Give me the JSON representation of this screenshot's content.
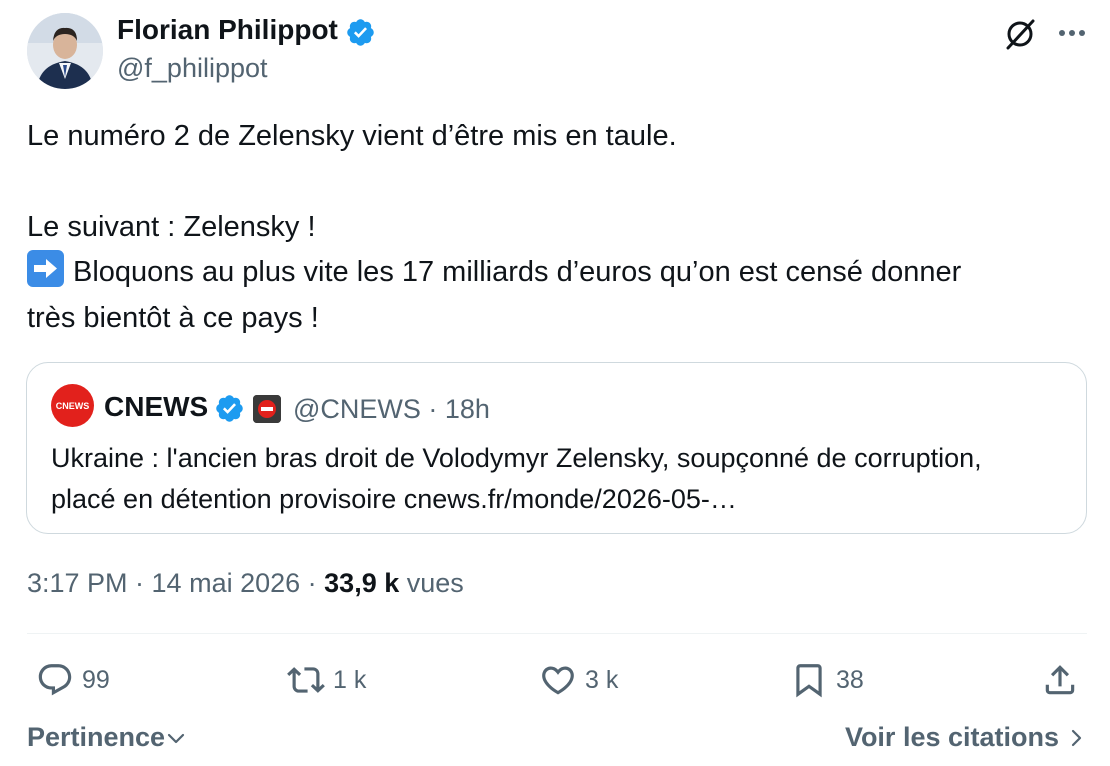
{
  "author": {
    "display_name": "Florian Philippot",
    "handle": "@f_philippot"
  },
  "tweet": {
    "line1": "Le numéro 2 de Zelensky vient d’être mis en taule.",
    "line2": "Le suivant : Zelensky !",
    "line3": "Bloquons au plus vite les 17 milliards d’euros qu’on est censé donner",
    "line4": "très bientôt à ce pays !"
  },
  "quoted": {
    "display_name": "CNEWS",
    "avatar_text": "CNEWS",
    "meta": "@CNEWS · 18h",
    "text_line1": "Ukraine : l'ancien bras droit de Volodymyr Zelensky, soupçonné de corruption,",
    "text_line2": "placé en détention provisoire cnews.fr/monde/2026-05-…"
  },
  "timestamp": {
    "time_date": "3:17 PM · 14 mai 2026 · ",
    "views_count": "33,9 k",
    "views_label": "vues"
  },
  "actions": {
    "replies": "99",
    "reposts": "1 k",
    "likes": "3 k",
    "bookmarks": "38"
  },
  "footer": {
    "sort_label": "Pertinence",
    "quotes_link": "Voir les citations"
  },
  "colors": {
    "verified": "#1d9bf0",
    "cnews_red": "#e2211c",
    "muted": "#536471",
    "text": "#0f1419"
  },
  "icons": [
    "verified-badge-icon",
    "grok-icon",
    "more-icon",
    "arrow-right-emoji",
    "reply-icon",
    "repost-icon",
    "like-icon",
    "bookmark-icon",
    "share-icon",
    "chevron-down-icon",
    "chevron-right-icon"
  ]
}
